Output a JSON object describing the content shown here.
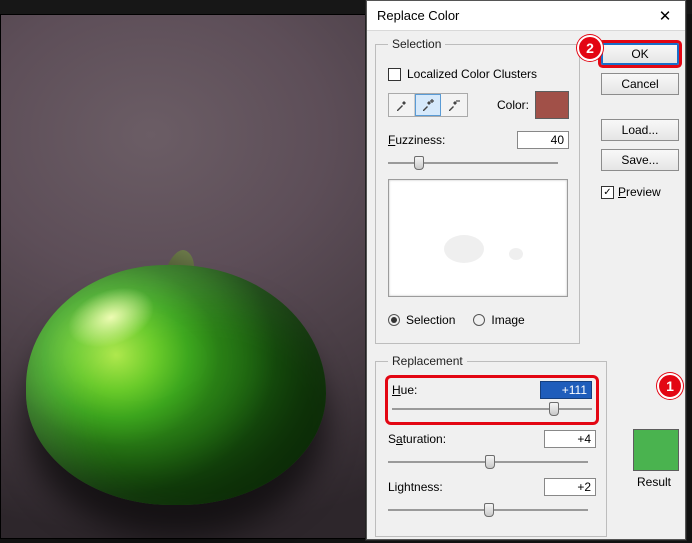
{
  "dialog": {
    "title": "Replace Color",
    "close": "✕",
    "buttons": {
      "ok": "OK",
      "cancel": "Cancel",
      "load": "Load...",
      "save": "Save..."
    },
    "preview_chk": "Preview",
    "preview_checked": "✓"
  },
  "selection": {
    "legend": "Selection",
    "localized": "Localized Color Clusters",
    "color_lbl": "Color:",
    "color_hex": "#a15048",
    "fuzziness_lbl": "Fuzziness:",
    "fuzziness": "40",
    "radio_selection": "Selection",
    "radio_image": "Image"
  },
  "replacement": {
    "legend": "Replacement",
    "hue_lbl": "Hue:",
    "hue": "+111",
    "sat_lbl": "Saturation:",
    "sat": "+4",
    "light_lbl": "Lightness:",
    "light": "+2",
    "result_lbl": "Result",
    "result_hex": "#4ab34f"
  },
  "callouts": {
    "c1": "1",
    "c2": "2"
  }
}
